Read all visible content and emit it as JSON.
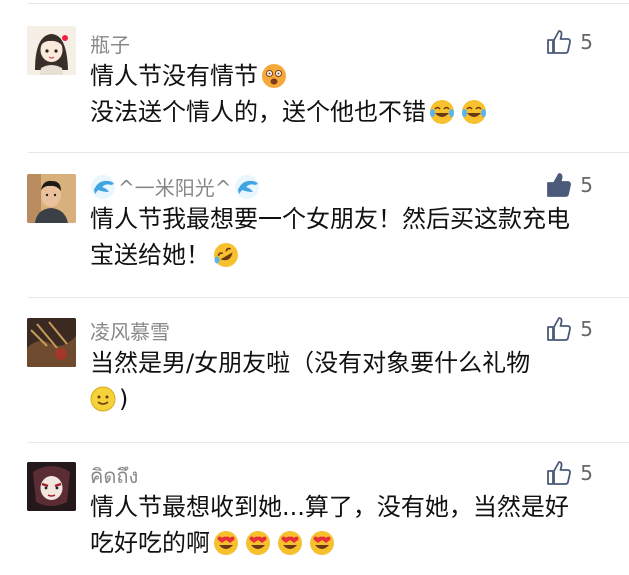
{
  "comments": [
    {
      "name": "瓶子",
      "likes": "5",
      "liked": false,
      "avatar_icon": "girl-avatar-icon",
      "lines": [
        "情人节没有情节",
        "没法送个情人的，送个他也不错"
      ],
      "line_emojis": [
        [
          "dizzy-face-emoji"
        ],
        [
          "tears-of-joy-emoji",
          "tears-of-joy-emoji"
        ]
      ]
    },
    {
      "name": "^一米阳光^",
      "name_icon": "dolphin-emoji",
      "likes": "5",
      "liked": true,
      "avatar_icon": "man-photo-avatar",
      "lines": [
        "情人节我最想要一个女朋友！然后买这款充电",
        "宝送给她！"
      ],
      "line_emojis": [
        [],
        [
          "rolling-laughing-emoji"
        ]
      ]
    },
    {
      "name": "凌风慕雪",
      "likes": "5",
      "liked": false,
      "avatar_icon": "dark-art-avatar",
      "lines": [
        "当然是男/女朋友啦（没有对象要什么礼物",
        ")"
      ],
      "line_emojis": [
        [],
        [
          "smile-emoji"
        ]
      ]
    },
    {
      "name": "คิดถึง",
      "likes": "5",
      "liked": false,
      "avatar_icon": "mask-character-avatar",
      "lines": [
        "情人节最想收到她...算了，没有她，当然是好",
        "吃好吃的啊"
      ],
      "line_emojis": [
        [],
        [
          "heart-eyes-emoji",
          "heart-eyes-emoji",
          "heart-eyes-emoji",
          "heart-eyes-emoji"
        ]
      ]
    }
  ],
  "colors": {
    "name": "#888888",
    "text": "#111111",
    "like_outline": "#4a5a78",
    "like_filled": "#4a5a78",
    "divider": "#e8e8e8",
    "emoji_yellow": "#f6c02e"
  }
}
